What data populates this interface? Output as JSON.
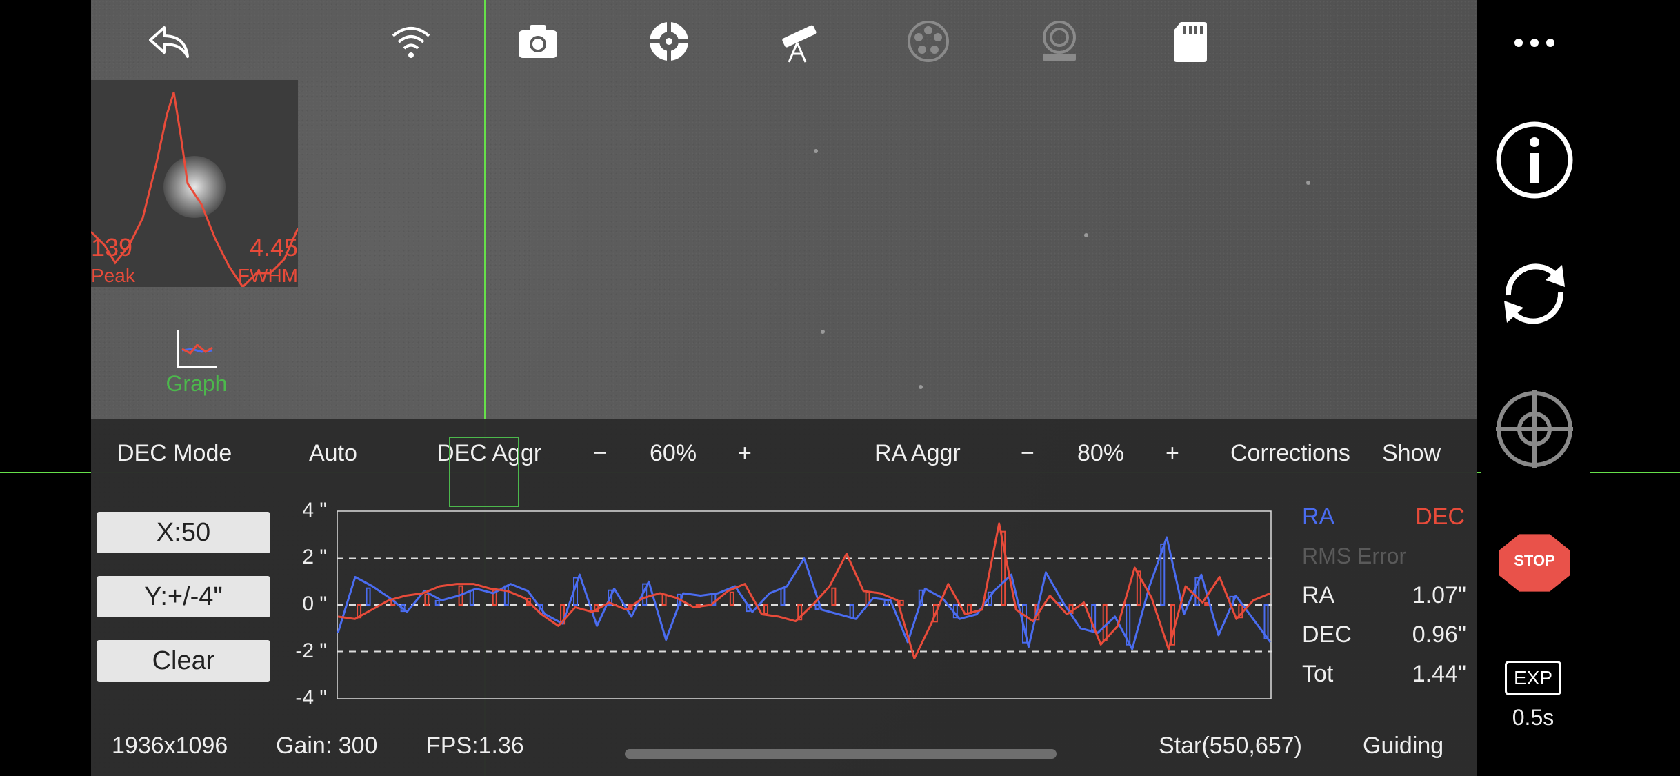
{
  "toolbar": {
    "icons": [
      "back-icon",
      "wifi-icon",
      "camera-icon",
      "guide-target-icon",
      "telescope-icon",
      "filter-wheel-icon",
      "focuser-icon",
      "sd-card-icon"
    ]
  },
  "star_profile": {
    "peak_value": "139",
    "peak_label": "Peak",
    "fwhm_value": "4.45",
    "fwhm_label": "FWHM"
  },
  "graph_button": {
    "label": "Graph"
  },
  "controls": {
    "dec_mode_label": "DEC Mode",
    "dec_mode_value": "Auto",
    "dec_aggr_label": "DEC Aggr",
    "dec_aggr_minus": "−",
    "dec_aggr_value": "60%",
    "dec_aggr_plus": "+",
    "ra_aggr_label": "RA Aggr",
    "ra_aggr_minus": "−",
    "ra_aggr_value": "80%",
    "ra_aggr_plus": "+",
    "corrections_label": "Corrections",
    "corrections_value": "Show"
  },
  "graph_buttons": {
    "x_scale": "X:50",
    "y_scale": "Y:+/-4\"",
    "clear": "Clear"
  },
  "stats": {
    "ra_legend": "RA",
    "dec_legend": "DEC",
    "rms_title": "RMS Error",
    "ra_label": "RA",
    "ra_value": "1.07\"",
    "dec_label": "DEC",
    "dec_value": "0.96\"",
    "tot_label": "Tot",
    "tot_value": "1.44\""
  },
  "status_bar": {
    "resolution": "1936x1096",
    "gain": "Gain: 300",
    "fps": "FPS:1.36",
    "star_pos": "Star(550,657)",
    "state": "Guiding"
  },
  "side": {
    "menu_icon": "more-icon",
    "info_icon": "info-icon",
    "loop_icon": "loop-icon",
    "target_icon": "crosshair-icon",
    "stop_label": "STOP",
    "exp_label": "EXP",
    "exp_value": "0.5s"
  },
  "colors": {
    "ra": "#4a6cf0",
    "dec": "#e84b3a",
    "accent_green": "#4cb84c",
    "guiding_yellow": "#f2c12e"
  },
  "chart_data": {
    "type": "line",
    "y_tick_labels": [
      "4 \"",
      "2 \"",
      "0 \"",
      "-2 \"",
      "-4 \""
    ],
    "ylim": [
      -4,
      4
    ],
    "x_count": 50,
    "series": [
      {
        "name": "RA",
        "values": [
          -1.2,
          1.2,
          0.8,
          0.3,
          -0.3,
          0.6,
          0.2,
          0.4,
          0.7,
          0.5,
          0.9,
          0.6,
          -0.4,
          -0.8,
          1.3,
          -0.9,
          0.7,
          -0.5,
          1.0,
          -1.5,
          0.5,
          0.4,
          0.5,
          0.8,
          -0.3,
          0.5,
          0.8,
          2.0,
          -0.2,
          -0.4,
          -0.6,
          0.3,
          0.2,
          -1.6,
          0.7,
          0.3,
          -0.6,
          -0.4,
          0.6,
          1.3,
          -1.8,
          1.4,
          0.1,
          -1.0,
          -1.2,
          -0.5,
          -1.9,
          0.8,
          2.9,
          -0.4,
          1.3,
          -1.3,
          0.4,
          -0.6,
          -1.6
        ]
      },
      {
        "name": "DEC",
        "values": [
          -0.5,
          -0.6,
          -0.2,
          0.2,
          0.4,
          0.5,
          0.8,
          0.9,
          0.9,
          0.7,
          0.6,
          0.3,
          -0.4,
          -0.9,
          -0.1,
          -0.3,
          0.1,
          -0.2,
          0.3,
          0.5,
          0.3,
          -0.1,
          0.0,
          0.6,
          0.9,
          -0.4,
          -0.5,
          -0.7,
          0.0,
          0.8,
          2.2,
          0.6,
          0.5,
          0.2,
          -2.3,
          -0.8,
          0.9,
          -0.4,
          -0.2,
          3.5,
          -0.2,
          -0.7,
          0.4,
          -0.4,
          0.1,
          -1.7,
          -0.9,
          1.6,
          0.3,
          -1.9,
          0.8,
          0.1,
          1.2,
          -0.6,
          0.2,
          0.5
        ]
      }
    ]
  }
}
